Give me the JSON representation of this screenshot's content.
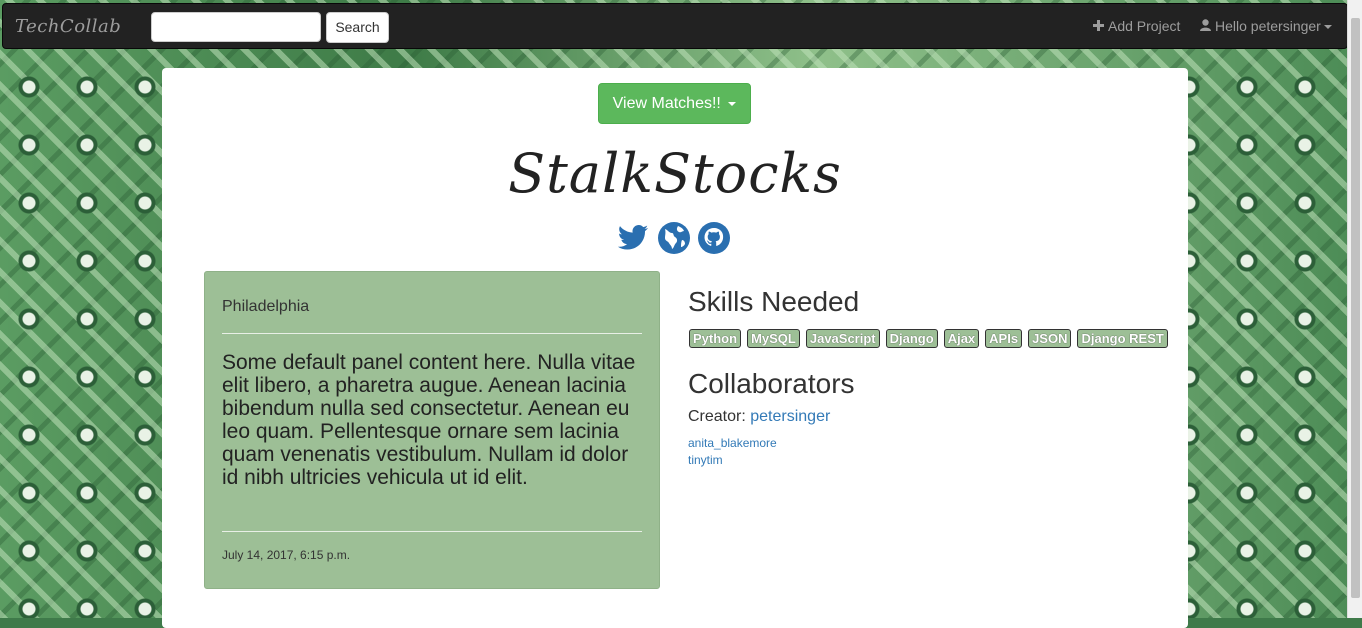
{
  "navbar": {
    "brand": "TechCollab",
    "search_placeholder": "",
    "search_button": "Search",
    "add_project": "Add Project",
    "user_greeting": "Hello petersinger"
  },
  "project": {
    "matches_button": "View Matches!!",
    "title": "StalkStocks",
    "social_icons": [
      "twitter-icon",
      "globe-icon",
      "github-icon"
    ],
    "location": "Philadelphia",
    "description": "Some default panel content here. Nulla vitae elit libero, a pharetra augue. Aenean lacinia bibendum nulla sed consectetur. Aenean eu leo quam. Pellentesque ornare sem lacinia quam venenatis vestibulum. Nullam id dolor id nibh ultricies vehicula ut id elit.",
    "date": "July 14, 2017, 6:15 p.m.",
    "skills_heading": "Skills Needed",
    "skills": [
      "Python",
      "MySQL",
      "JavaScript",
      "Django",
      "Ajax",
      "APIs",
      "JSON",
      "Django REST"
    ],
    "collaborators_heading": "Collaborators",
    "creator_label": "Creator:",
    "creator": "petersinger",
    "collaborators": [
      "anita_blakemore",
      "tinytim"
    ]
  },
  "colors": {
    "accent": "#5cb85c",
    "panel": "#9dbf96",
    "link": "#337ab7",
    "social": "#2a6fb0"
  }
}
